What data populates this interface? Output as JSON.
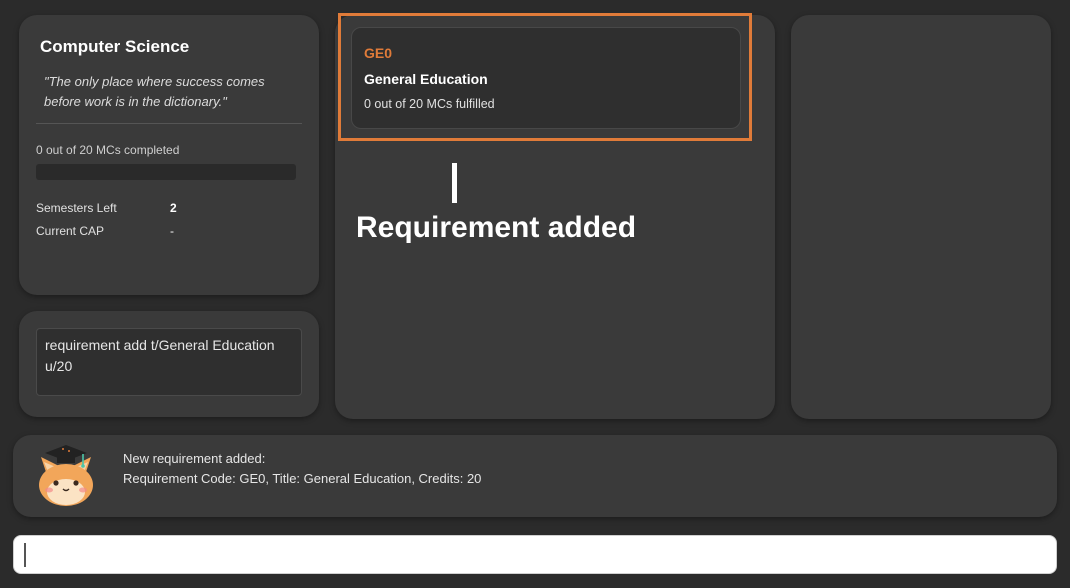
{
  "profile": {
    "name": "Computer Science",
    "quote": "\"The only place where success comes before work is in the dictionary.\"",
    "progress_text": "0 out of 20 MCs completed",
    "progress_fraction": 0,
    "semesters_left_label": "Semesters Left",
    "semesters_left_value": "2",
    "cap_label": "Current CAP",
    "cap_value": "-"
  },
  "last_command": {
    "text": "requirement add t/General Education u/20"
  },
  "requirements": [
    {
      "code": "GE0",
      "title": "General Education",
      "mcs": "0 out of 20 MCs fulfilled"
    }
  ],
  "annotation": {
    "text": "Requirement added"
  },
  "result": {
    "line1": "New requirement added:",
    "line2": "Requirement Code: GE0, Title: General Education, Credits: 20"
  },
  "command_input": {
    "value": ""
  },
  "colors": {
    "accent": "#e07b39",
    "panel": "#3a3a3a",
    "background": "#2b2b2b"
  },
  "icons": {
    "mascot": "graduate-fox-icon"
  }
}
